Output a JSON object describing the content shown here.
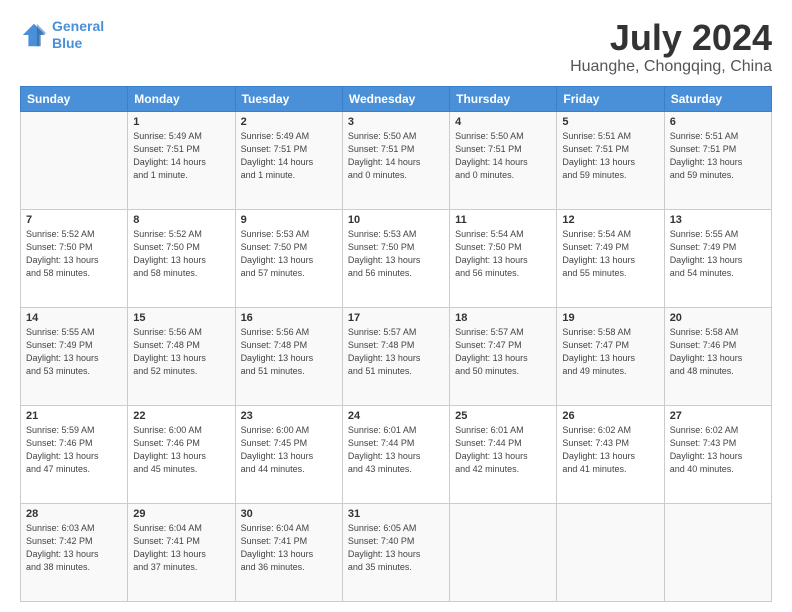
{
  "logo": {
    "line1": "General",
    "line2": "Blue"
  },
  "title": "July 2024",
  "subtitle": "Huanghe, Chongqing, China",
  "weekdays": [
    "Sunday",
    "Monday",
    "Tuesday",
    "Wednesday",
    "Thursday",
    "Friday",
    "Saturday"
  ],
  "weeks": [
    [
      {
        "day": "",
        "info": ""
      },
      {
        "day": "1",
        "info": "Sunrise: 5:49 AM\nSunset: 7:51 PM\nDaylight: 14 hours\nand 1 minute."
      },
      {
        "day": "2",
        "info": "Sunrise: 5:49 AM\nSunset: 7:51 PM\nDaylight: 14 hours\nand 1 minute."
      },
      {
        "day": "3",
        "info": "Sunrise: 5:50 AM\nSunset: 7:51 PM\nDaylight: 14 hours\nand 0 minutes."
      },
      {
        "day": "4",
        "info": "Sunrise: 5:50 AM\nSunset: 7:51 PM\nDaylight: 14 hours\nand 0 minutes."
      },
      {
        "day": "5",
        "info": "Sunrise: 5:51 AM\nSunset: 7:51 PM\nDaylight: 13 hours\nand 59 minutes."
      },
      {
        "day": "6",
        "info": "Sunrise: 5:51 AM\nSunset: 7:51 PM\nDaylight: 13 hours\nand 59 minutes."
      }
    ],
    [
      {
        "day": "7",
        "info": "Sunrise: 5:52 AM\nSunset: 7:50 PM\nDaylight: 13 hours\nand 58 minutes."
      },
      {
        "day": "8",
        "info": "Sunrise: 5:52 AM\nSunset: 7:50 PM\nDaylight: 13 hours\nand 58 minutes."
      },
      {
        "day": "9",
        "info": "Sunrise: 5:53 AM\nSunset: 7:50 PM\nDaylight: 13 hours\nand 57 minutes."
      },
      {
        "day": "10",
        "info": "Sunrise: 5:53 AM\nSunset: 7:50 PM\nDaylight: 13 hours\nand 56 minutes."
      },
      {
        "day": "11",
        "info": "Sunrise: 5:54 AM\nSunset: 7:50 PM\nDaylight: 13 hours\nand 56 minutes."
      },
      {
        "day": "12",
        "info": "Sunrise: 5:54 AM\nSunset: 7:49 PM\nDaylight: 13 hours\nand 55 minutes."
      },
      {
        "day": "13",
        "info": "Sunrise: 5:55 AM\nSunset: 7:49 PM\nDaylight: 13 hours\nand 54 minutes."
      }
    ],
    [
      {
        "day": "14",
        "info": "Sunrise: 5:55 AM\nSunset: 7:49 PM\nDaylight: 13 hours\nand 53 minutes."
      },
      {
        "day": "15",
        "info": "Sunrise: 5:56 AM\nSunset: 7:48 PM\nDaylight: 13 hours\nand 52 minutes."
      },
      {
        "day": "16",
        "info": "Sunrise: 5:56 AM\nSunset: 7:48 PM\nDaylight: 13 hours\nand 51 minutes."
      },
      {
        "day": "17",
        "info": "Sunrise: 5:57 AM\nSunset: 7:48 PM\nDaylight: 13 hours\nand 51 minutes."
      },
      {
        "day": "18",
        "info": "Sunrise: 5:57 AM\nSunset: 7:47 PM\nDaylight: 13 hours\nand 50 minutes."
      },
      {
        "day": "19",
        "info": "Sunrise: 5:58 AM\nSunset: 7:47 PM\nDaylight: 13 hours\nand 49 minutes."
      },
      {
        "day": "20",
        "info": "Sunrise: 5:58 AM\nSunset: 7:46 PM\nDaylight: 13 hours\nand 48 minutes."
      }
    ],
    [
      {
        "day": "21",
        "info": "Sunrise: 5:59 AM\nSunset: 7:46 PM\nDaylight: 13 hours\nand 47 minutes."
      },
      {
        "day": "22",
        "info": "Sunrise: 6:00 AM\nSunset: 7:46 PM\nDaylight: 13 hours\nand 45 minutes."
      },
      {
        "day": "23",
        "info": "Sunrise: 6:00 AM\nSunset: 7:45 PM\nDaylight: 13 hours\nand 44 minutes."
      },
      {
        "day": "24",
        "info": "Sunrise: 6:01 AM\nSunset: 7:44 PM\nDaylight: 13 hours\nand 43 minutes."
      },
      {
        "day": "25",
        "info": "Sunrise: 6:01 AM\nSunset: 7:44 PM\nDaylight: 13 hours\nand 42 minutes."
      },
      {
        "day": "26",
        "info": "Sunrise: 6:02 AM\nSunset: 7:43 PM\nDaylight: 13 hours\nand 41 minutes."
      },
      {
        "day": "27",
        "info": "Sunrise: 6:02 AM\nSunset: 7:43 PM\nDaylight: 13 hours\nand 40 minutes."
      }
    ],
    [
      {
        "day": "28",
        "info": "Sunrise: 6:03 AM\nSunset: 7:42 PM\nDaylight: 13 hours\nand 38 minutes."
      },
      {
        "day": "29",
        "info": "Sunrise: 6:04 AM\nSunset: 7:41 PM\nDaylight: 13 hours\nand 37 minutes."
      },
      {
        "day": "30",
        "info": "Sunrise: 6:04 AM\nSunset: 7:41 PM\nDaylight: 13 hours\nand 36 minutes."
      },
      {
        "day": "31",
        "info": "Sunrise: 6:05 AM\nSunset: 7:40 PM\nDaylight: 13 hours\nand 35 minutes."
      },
      {
        "day": "",
        "info": ""
      },
      {
        "day": "",
        "info": ""
      },
      {
        "day": "",
        "info": ""
      }
    ]
  ]
}
